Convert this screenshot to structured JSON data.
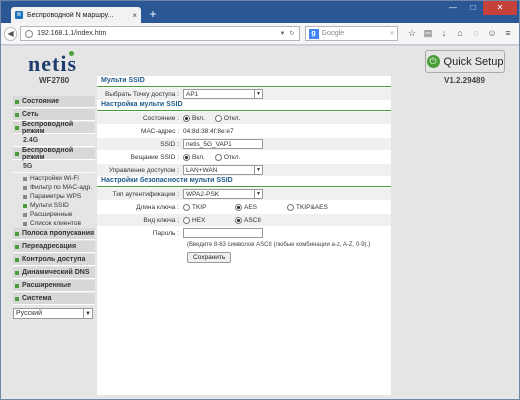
{
  "browser": {
    "tab_title": "Беспроводной N маршру...",
    "tab_close": "×",
    "new_tab": "+",
    "url": "192.168.1.1/index.htm",
    "search_engine_glyph": "g",
    "search_placeholder": "Google",
    "win_min": "—",
    "win_max": "□",
    "win_close": "✕"
  },
  "header": {
    "logo": "netis",
    "quick_setup": "Quick Setup",
    "model": "WF2780",
    "version": "V1.2.29489"
  },
  "sidebar": {
    "items": [
      {
        "label": "Состояние"
      },
      {
        "label": "Сеть"
      },
      {
        "label": "Беспроводной режим"
      },
      {
        "label": "2.4G"
      },
      {
        "label": "Беспроводной режим"
      },
      {
        "label": "5G"
      }
    ],
    "sub_items": [
      {
        "label": "Настройки Wi-Fi"
      },
      {
        "label": "Фильтр по MAC-адр."
      },
      {
        "label": "Параметры WPS"
      },
      {
        "label": "Мульти SSID"
      },
      {
        "label": "Расширенные"
      },
      {
        "label": "Список клиентов"
      }
    ],
    "more_items": [
      {
        "label": "Полоса пропускания"
      },
      {
        "label": "Переадресация"
      },
      {
        "label": "Контроль доступа"
      },
      {
        "label": "Динамический DNS"
      },
      {
        "label": "Расширенные"
      },
      {
        "label": "Система"
      }
    ],
    "language": "Русский"
  },
  "main": {
    "section1_title": "Мульти SSID",
    "select_ap_label": "Выбрать Точку доступа :",
    "select_ap_value": "AP1",
    "section2_title": "Настройка мульти SSID",
    "state_label": "Состояние :",
    "on_label": "Вкл.",
    "off_label": "Откл.",
    "mac_label": "МАС-адрес :",
    "mac_value": "04:8d:38:4f:8e:e7",
    "ssid_label": "SSID :",
    "ssid_value": "netis_5G_VAP1",
    "broadcast_label": "Вещание SSID :",
    "access_label": "Управление доступом :",
    "access_value": "LAN+WAN",
    "section3_title": "Настройки безопасности мульти SSID",
    "auth_label": "Тип аутентификации :",
    "auth_value": "WPA2-PSK",
    "keylen_label": "Длина ключа :",
    "keylen_options": [
      "TKIP",
      "AES",
      "TKIP&AES"
    ],
    "keytype_label": "Вид ключа :",
    "keytype_options": [
      "HEX",
      "ASCII"
    ],
    "password_label": "Пароль :",
    "password_value": "",
    "hint": "(Введите 8-63 символов ASCII (любые комбинации a-z, A-Z, 0-9).)",
    "save_button": "Сохранить"
  }
}
